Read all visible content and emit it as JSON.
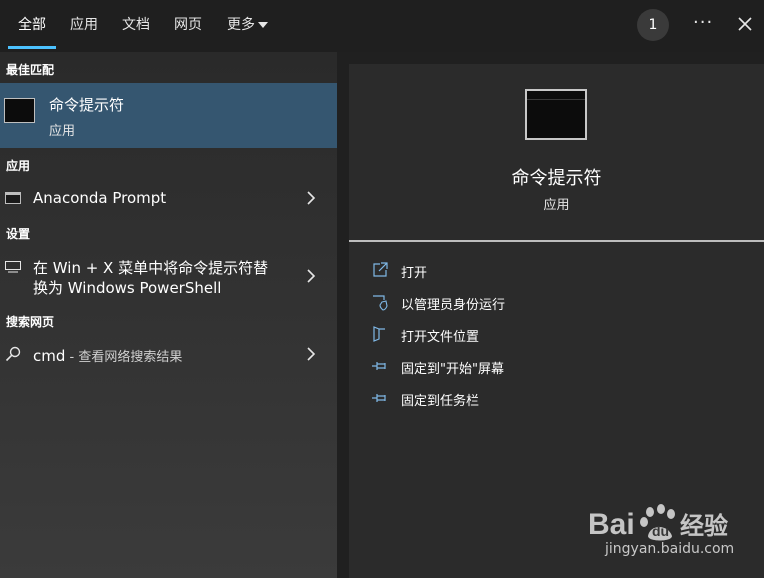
{
  "tabs": [
    {
      "label": "全部"
    },
    {
      "label": "应用"
    },
    {
      "label": "文档"
    },
    {
      "label": "网页"
    },
    {
      "label": "更多"
    }
  ],
  "badge_count": "1",
  "more_options": "···",
  "left": {
    "best_match_header": "最佳匹配",
    "best_match": {
      "title": "命令提示符",
      "subtitle": "应用"
    },
    "apps_header": "应用",
    "apps": [
      {
        "label": "Anaconda Prompt"
      }
    ],
    "settings_header": "设置",
    "settings": [
      {
        "line1": "在 Win + X 菜单中将命令提示符替",
        "line2": "换为 Windows PowerShell"
      }
    ],
    "web_header": "搜索网页",
    "web": {
      "query": "cmd",
      "suffix": " - 查看网络搜索结果"
    }
  },
  "right": {
    "title": "命令提示符",
    "subtitle": "应用",
    "actions": [
      {
        "label": "打开",
        "icon": "open-icon"
      },
      {
        "label": "以管理员身份运行",
        "icon": "shield-icon"
      },
      {
        "label": "打开文件位置",
        "icon": "file-location-icon"
      },
      {
        "label": "固定到\"开始\"屏幕",
        "icon": "pin-icon"
      },
      {
        "label": "固定到任务栏",
        "icon": "pin-icon"
      }
    ]
  },
  "watermark": {
    "brand": "Bai du 经验",
    "url": "jingyan.baidu.com"
  },
  "colors": {
    "accent": "#4cc2ff",
    "selected": "#355670",
    "background": "#202020"
  }
}
